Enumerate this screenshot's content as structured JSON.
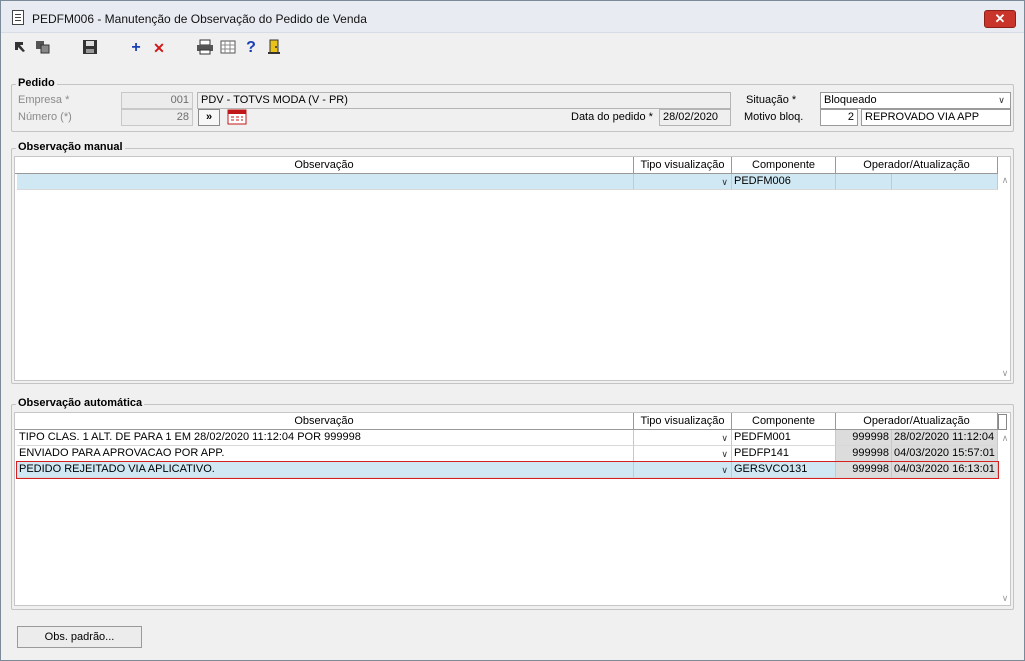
{
  "window": {
    "title": "PEDFM006 - Manutenção de Observação do Pedido de Venda",
    "close": "✕"
  },
  "toolbar": {
    "icons": [
      "nav-first-icon",
      "nav-copy-icon",
      "save-icon",
      "add-icon",
      "delete-icon",
      "print-icon",
      "grid-icon",
      "help-icon",
      "exit-icon"
    ],
    "add": "+",
    "delete": "✕",
    "help": "?"
  },
  "pedido": {
    "legend": "Pedido",
    "empresa_label": "Empresa *",
    "empresa_code": "001",
    "empresa_name": "PDV - TOTVS MODA (V - PR)",
    "numero_label": "Número (*)",
    "numero_value": "28",
    "next_button": "»",
    "data_label": "Data do pedido *",
    "data_value": "28/02/2020",
    "situacao_label": "Situação *",
    "situacao_value": "Bloqueado",
    "motivo_label": "Motivo bloq.",
    "motivo_code": "2",
    "motivo_desc": "REPROVADO VIA APP"
  },
  "manual": {
    "legend": "Observação manual",
    "columns": [
      "Observação",
      "Tipo visualização",
      "Componente",
      "Operador/Atualização"
    ],
    "rows": [
      {
        "observacao": "",
        "tipo": "",
        "componente": "PEDFM006",
        "operador": "",
        "atualizacao": ""
      }
    ]
  },
  "automatica": {
    "legend": "Observação automática",
    "columns": [
      "Observação",
      "Tipo visualização",
      "Componente",
      "Operador/Atualização"
    ],
    "rows": [
      {
        "observacao": "TIPO CLAS. 1 ALT. DE  PARA 1 EM 28/02/2020 11:12:04 POR 999998",
        "tipo": "",
        "componente": "PEDFM001",
        "operador": "999998",
        "atualizacao": "28/02/2020 11:12:04"
      },
      {
        "observacao": "ENVIADO PARA APROVACAO POR APP.",
        "tipo": "",
        "componente": "PEDFP141",
        "operador": "999998",
        "atualizacao": "04/03/2020 15:57:01"
      },
      {
        "observacao": "PEDIDO REJEITADO VIA APLICATIVO.",
        "tipo": "",
        "componente": "GERSVCO131",
        "operador": "999998",
        "atualizacao": "04/03/2020 16:13:01"
      }
    ]
  },
  "footer": {
    "obs_padrao": "Obs. padrão..."
  }
}
